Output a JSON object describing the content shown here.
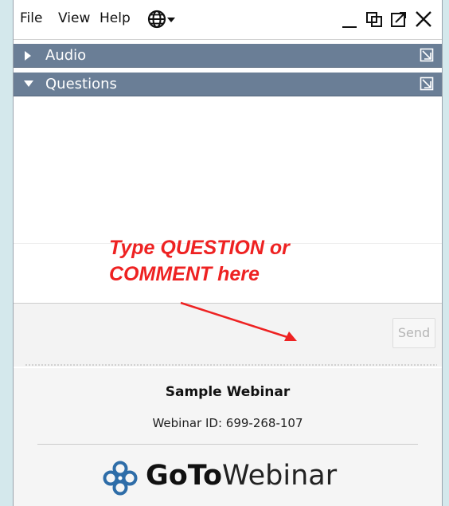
{
  "menubar": {
    "items": [
      "File",
      "View",
      "Help"
    ],
    "icons": {
      "language": "globe-icon",
      "minimize": "minimize-icon",
      "restore": "restore-icon",
      "popout": "popout-icon",
      "close": "close-icon"
    }
  },
  "sections": [
    {
      "label": "Audio",
      "expanded": false
    },
    {
      "label": "Questions",
      "expanded": true
    }
  ],
  "annotation": {
    "line1": "Type QUESTION or",
    "line2": "COMMENT here",
    "color": "#ee2222"
  },
  "question_input": {
    "value": "",
    "send_label": "Send"
  },
  "webinar": {
    "title": "Sample Webinar",
    "id_text": "Webinar ID: 699-268-107"
  },
  "brand": {
    "bold": "GoTo",
    "light": "Webinar",
    "icon": "gotowebinar-logo-icon",
    "accent": "#2e6da8"
  },
  "colors": {
    "header_bg": "#6a7e96",
    "page_bg": "#d4e8ec"
  }
}
